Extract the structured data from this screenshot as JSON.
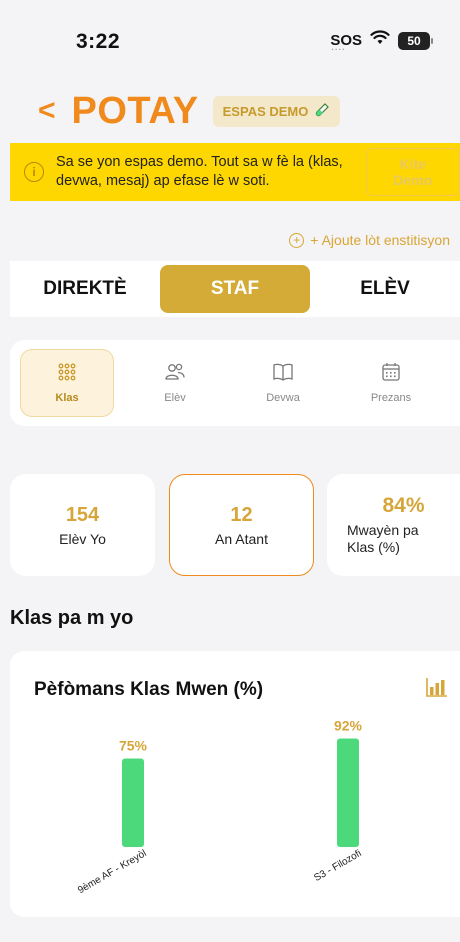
{
  "status_bar": {
    "time": "3:22",
    "sos": "SOS",
    "battery": "50"
  },
  "header": {
    "title": "POTAY",
    "badge": "ESPAS DEMO"
  },
  "banner": {
    "text": "Sa se yon espas demo. Tout sa w fè la (klas, devwa, mesaj) ap efase lè w soti.",
    "exit_label": "Kite Demo"
  },
  "add_institution": "+ Ajoute lòt enstitisyon",
  "role_tabs": [
    {
      "label": "DIREKTÈ"
    },
    {
      "label": "STAF"
    },
    {
      "label": "ELÈV"
    }
  ],
  "nav": [
    {
      "label": "Klas",
      "icon": "grid-icon"
    },
    {
      "label": "Elèv",
      "icon": "users-icon"
    },
    {
      "label": "Devwa",
      "icon": "book-icon"
    },
    {
      "label": "Prezans",
      "icon": "calendar-icon"
    }
  ],
  "stats": [
    {
      "value": "154",
      "label": "Elèv Yo"
    },
    {
      "value": "12",
      "label": "An Atant"
    },
    {
      "value": "84%",
      "label": "Mwayèn pa Klas (%)"
    }
  ],
  "section_title": "Klas pa m yo",
  "chart_data": {
    "type": "bar",
    "title": "Pèfòmans Klas Mwen (%)",
    "categories": [
      "9ème AF - Kreyòl",
      "S3 - Filozofi"
    ],
    "values": [
      75,
      92
    ],
    "value_labels": [
      "75%",
      "92%"
    ],
    "ylim": [
      0,
      100
    ],
    "bar_color": "#4cd97b",
    "label_color": "#d6a63a"
  },
  "colors": {
    "accent": "#f08a1d",
    "gold": "#d3ab36",
    "banner": "#ffd700"
  }
}
